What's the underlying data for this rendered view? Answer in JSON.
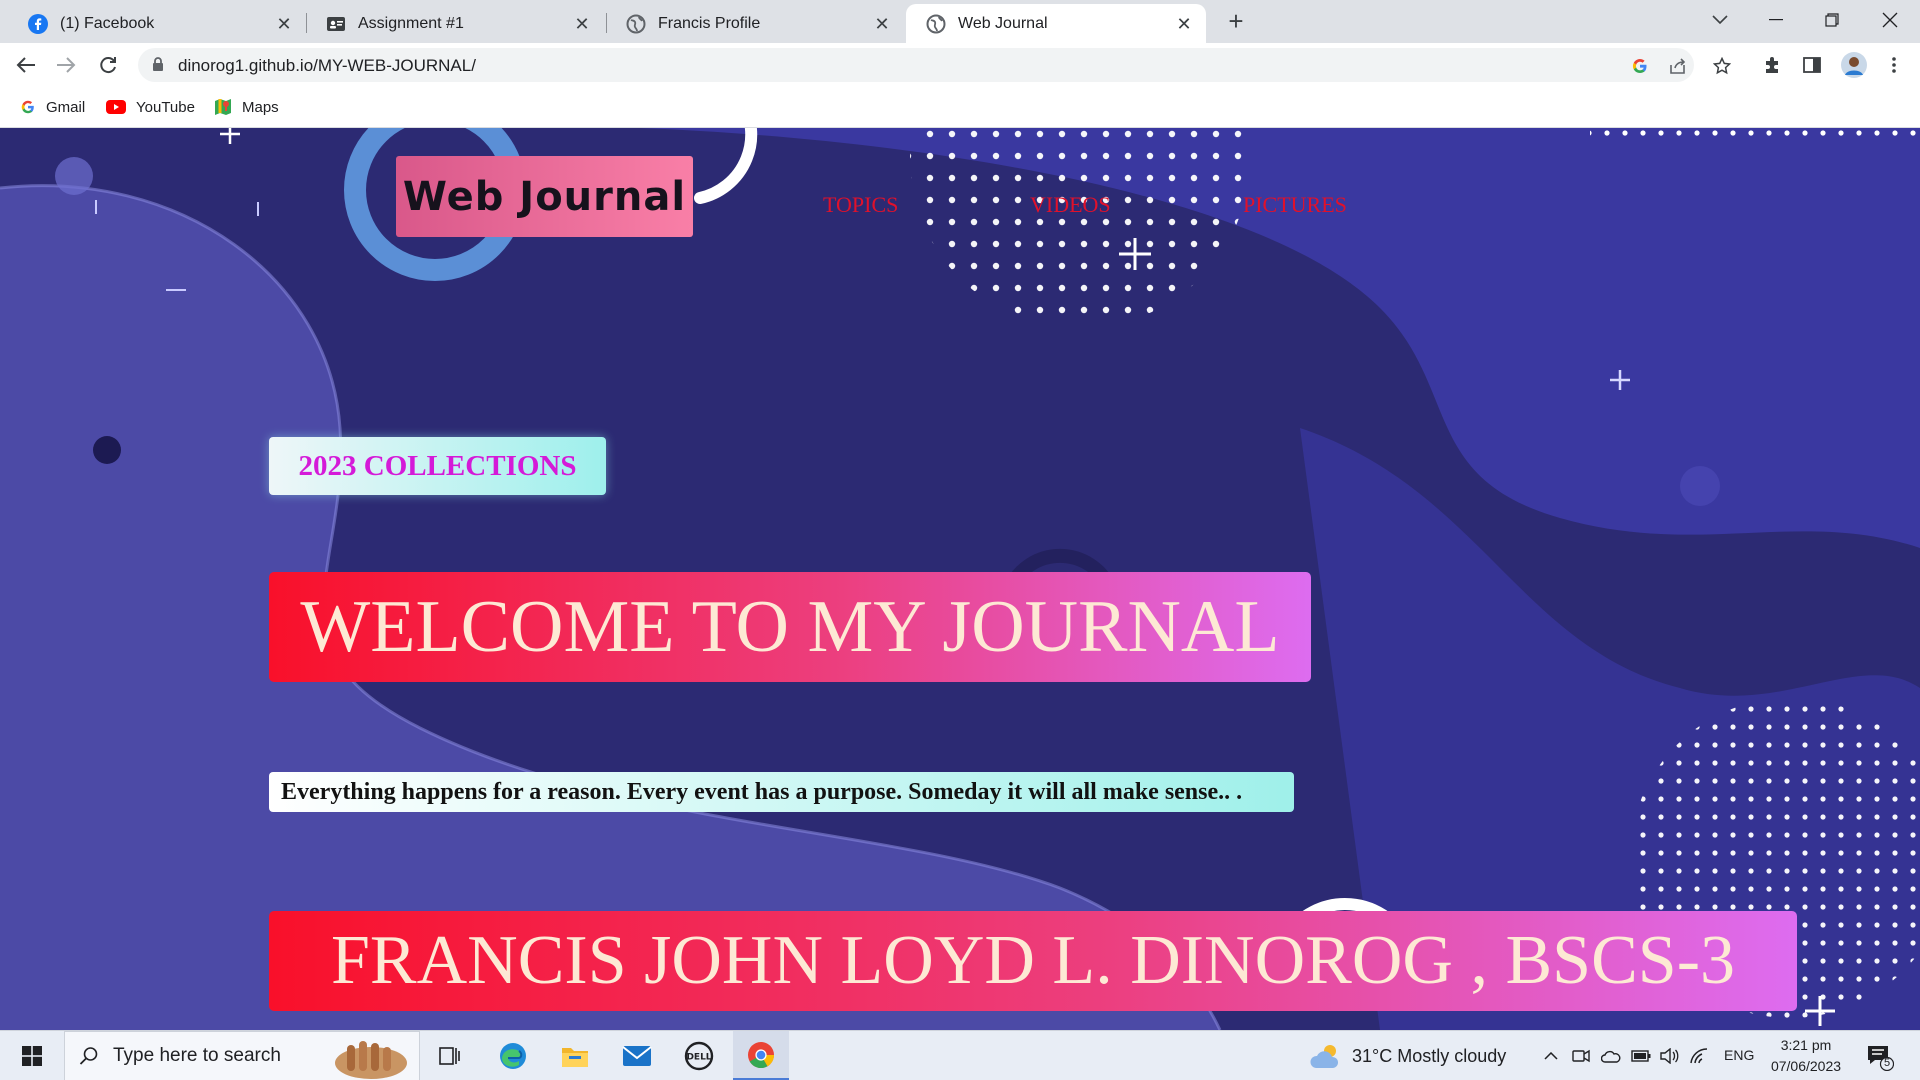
{
  "browser": {
    "tabs": [
      {
        "title": "(1) Facebook",
        "icon": "facebook-icon",
        "active": false
      },
      {
        "title": "Assignment #1",
        "icon": "classroom-icon",
        "active": false
      },
      {
        "title": "Francis Profile",
        "icon": "globe-icon",
        "active": false
      },
      {
        "title": "Web Journal",
        "icon": "globe-icon",
        "active": true
      }
    ],
    "url": "dinorog1.github.io/MY-WEB-JOURNAL/",
    "bookmarks": [
      {
        "label": "Gmail",
        "icon": "google-icon"
      },
      {
        "label": "YouTube",
        "icon": "youtube-icon"
      },
      {
        "label": "Maps",
        "icon": "maps-icon"
      }
    ]
  },
  "page": {
    "brand": "Web Journal",
    "nav": [
      "TOPICS",
      "VIDEOS",
      "PICTURES"
    ],
    "badge": "2023 COLLECTIONS",
    "welcome": "WELCOME TO MY JOURNAL",
    "quote": "Everything happens for a reason. Every event has a purpose. Someday it will all make sense.. .",
    "name": "FRANCIS JOHN LOYD L. DINOROG , BSCS-3",
    "colors": {
      "background": "#2c2a73",
      "brand_box": "#f97fa7",
      "nav_link": "#e0112b",
      "badge_text": "#d41ad8",
      "gradient_start": "#f9102a",
      "gradient_end": "#dd6cf0"
    }
  },
  "taskbar": {
    "search_placeholder": "Type here to search",
    "weather": "31°C  Mostly cloudy",
    "language": "ENG",
    "time": "3:21 pm",
    "date": "07/06/2023",
    "notification_count": "5"
  }
}
